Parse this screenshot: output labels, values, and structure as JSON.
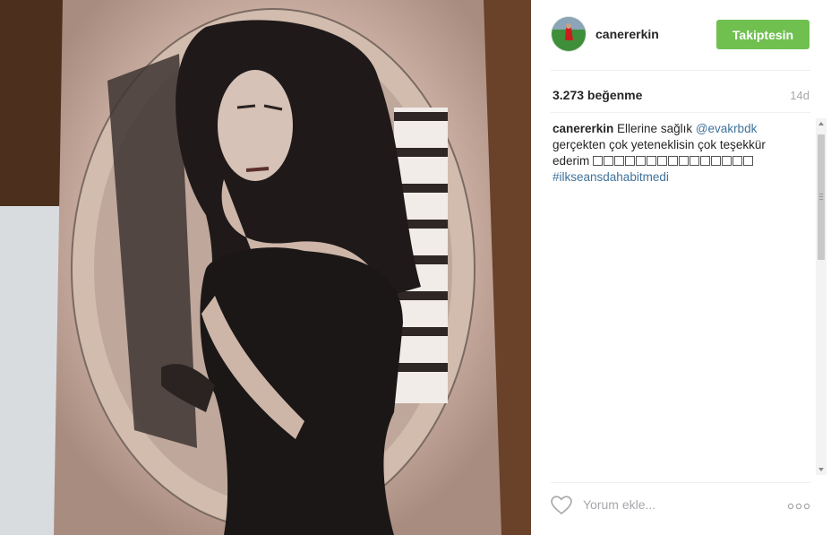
{
  "post": {
    "image_alt": "tattoo photo",
    "username": "canererkin",
    "follow_label": "Takiptesin",
    "likes": "3.273 beğenme",
    "age": "14d",
    "caption": {
      "username": "canererkin",
      "text_before": " Ellerine sağlık ",
      "mention": "@evakrbdk",
      "text_after": " gerçekten çok yeteneklisin çok teşekkür ederim",
      "emoji_count": 15,
      "hashtag": "#ilkseansdahabitmedi"
    },
    "comment_placeholder": "Yorum ekle...",
    "colors": {
      "follow": "#70c050",
      "link": "#3f729b"
    },
    "icons": [
      "heart-icon",
      "more-options-icon"
    ]
  }
}
